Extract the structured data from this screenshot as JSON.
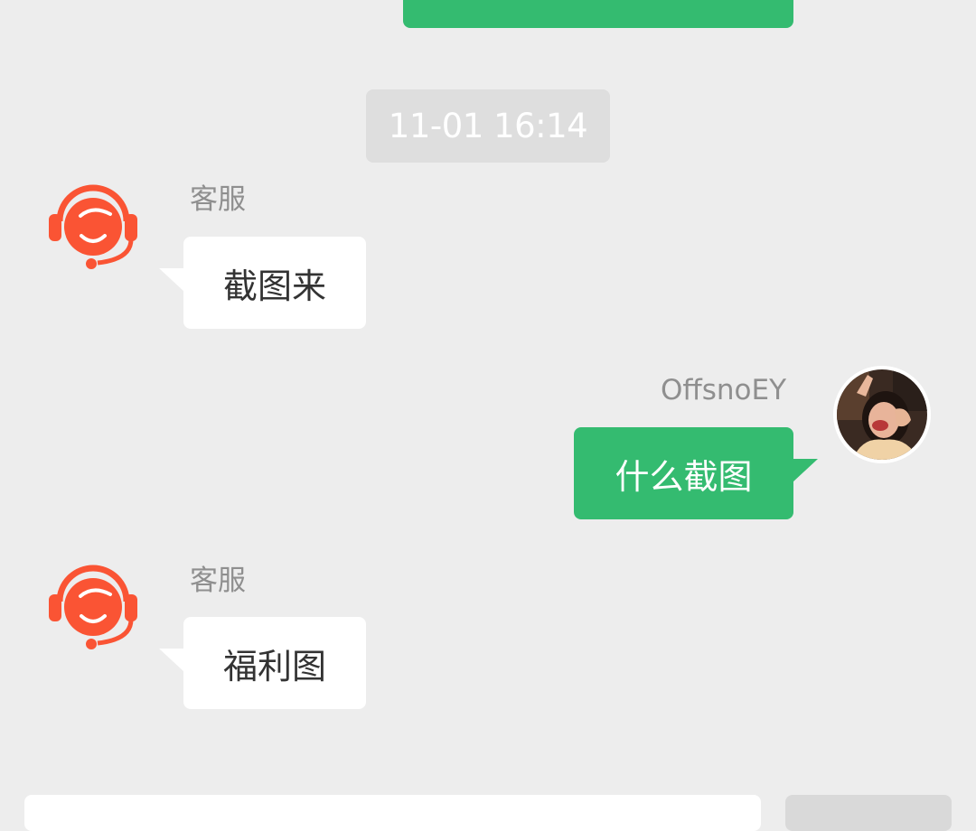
{
  "chat": {
    "timestamp": "11-01 16:14",
    "messages": [
      {
        "side": "left",
        "sender": "客服",
        "text": "截图来"
      },
      {
        "side": "right",
        "sender": "OffsnoEY",
        "text": "什么截图"
      },
      {
        "side": "left",
        "sender": "客服",
        "text": "福利图"
      }
    ]
  },
  "icons": {
    "agent_avatar": "customer-service-headset-icon",
    "user_avatar": "user-photo-avatar"
  },
  "colors": {
    "background": "#ededed",
    "self_bubble": "#34bb70",
    "other_bubble": "#ffffff",
    "agent_icon": "#fa5434",
    "timestamp_bg": "#dedede",
    "sender_text": "#8f8f8f"
  }
}
